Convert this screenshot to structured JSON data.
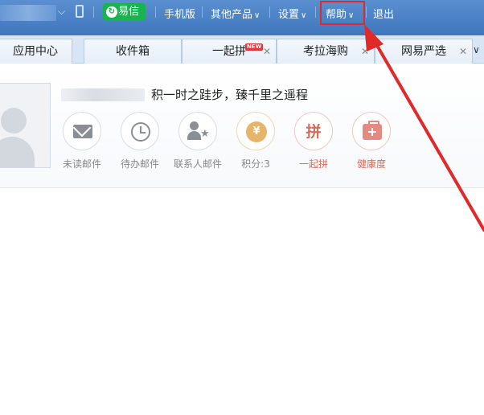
{
  "topbar": {
    "yixin_label": "易信",
    "mobile_label": "手机版",
    "other_products_label": "其他产品",
    "settings_label": "设置",
    "help_label": "帮助",
    "logout_label": "退出"
  },
  "tabs": [
    {
      "label": "应用中心"
    },
    {
      "label": "收件箱"
    },
    {
      "label": "一起拼",
      "badge": "NEW"
    },
    {
      "label": "考拉海购"
    },
    {
      "label": "网易严选"
    }
  ],
  "profile": {
    "slogan": "积一时之跬步，臻千里之遥程",
    "stats": [
      {
        "label": "未读邮件",
        "icon": "mail-icon"
      },
      {
        "label": "待办邮件",
        "icon": "clock-icon"
      },
      {
        "label": "联系人邮件",
        "icon": "contact-star-icon"
      },
      {
        "label": "积分:3",
        "icon": "points-coin-icon"
      },
      {
        "label": "一起拼",
        "icon": "pin-icon",
        "glyph": "拼"
      },
      {
        "label": "健康度",
        "icon": "health-kit-icon"
      }
    ]
  },
  "colors": {
    "topbar": "#4a82c6",
    "yixin_green": "#19b34f",
    "annotation_red": "#e02a2a"
  }
}
